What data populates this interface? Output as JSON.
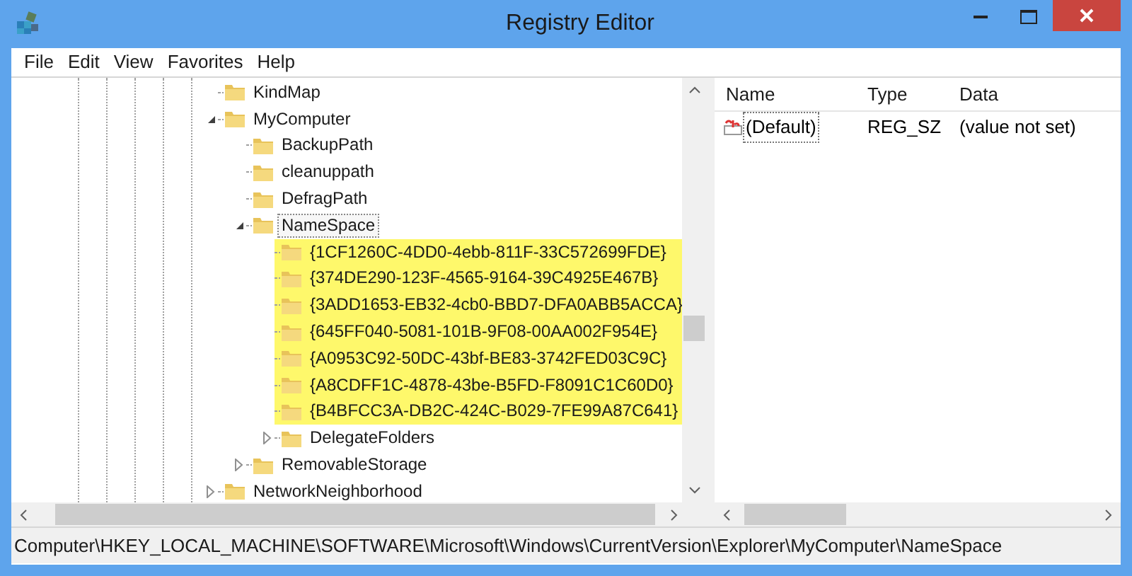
{
  "window": {
    "title": "Registry Editor"
  },
  "menu": [
    "File",
    "Edit",
    "View",
    "Favorites",
    "Help"
  ],
  "tree": [
    {
      "label": "KindMap",
      "selected": false,
      "highlighted": false
    },
    {
      "label": "MyComputer",
      "expanded": true,
      "selected": false,
      "highlighted": false,
      "children": [
        {
          "label": "BackupPath",
          "selected": false,
          "highlighted": false
        },
        {
          "label": "cleanuppath",
          "selected": false,
          "highlighted": false
        },
        {
          "label": "DefragPath",
          "selected": false,
          "highlighted": false
        },
        {
          "label": "NameSpace",
          "expanded": true,
          "selected": true,
          "highlighted": false,
          "children": [
            {
              "label": "{1CF1260C-4DD0-4ebb-811F-33C572699FDE}",
              "selected": false,
              "highlighted": true
            },
            {
              "label": "{374DE290-123F-4565-9164-39C4925E467B}",
              "selected": false,
              "highlighted": true
            },
            {
              "label": "{3ADD1653-EB32-4cb0-BBD7-DFA0ABB5ACCA}",
              "selected": false,
              "highlighted": true
            },
            {
              "label": "{645FF040-5081-101B-9F08-00AA002F954E}",
              "selected": false,
              "highlighted": true
            },
            {
              "label": "{A0953C92-50DC-43bf-BE83-3742FED03C9C}",
              "selected": false,
              "highlighted": true
            },
            {
              "label": "{A8CDFF1C-4878-43be-B5FD-F8091C1C60D0}",
              "selected": false,
              "highlighted": true
            },
            {
              "label": "{B4BFCC3A-DB2C-424C-B029-7FE99A87C641}",
              "selected": false,
              "highlighted": true
            },
            {
              "label": "DelegateFolders",
              "expanded": false,
              "selected": false,
              "highlighted": false
            }
          ]
        },
        {
          "label": "RemovableStorage",
          "expanded": false,
          "selected": false,
          "highlighted": false
        }
      ]
    },
    {
      "label": "NetworkNeighborhood",
      "expanded": false,
      "selected": false,
      "highlighted": false
    }
  ],
  "values": {
    "columns": [
      "Name",
      "Type",
      "Data"
    ],
    "rows": [
      {
        "name": "(Default)",
        "type": "REG_SZ",
        "data": "(value not set)",
        "focused": true
      }
    ]
  },
  "status_bar": "Computer\\HKEY_LOCAL_MACHINE\\SOFTWARE\\Microsoft\\Windows\\CurrentVersion\\Explorer\\MyComputer\\NameSpace"
}
